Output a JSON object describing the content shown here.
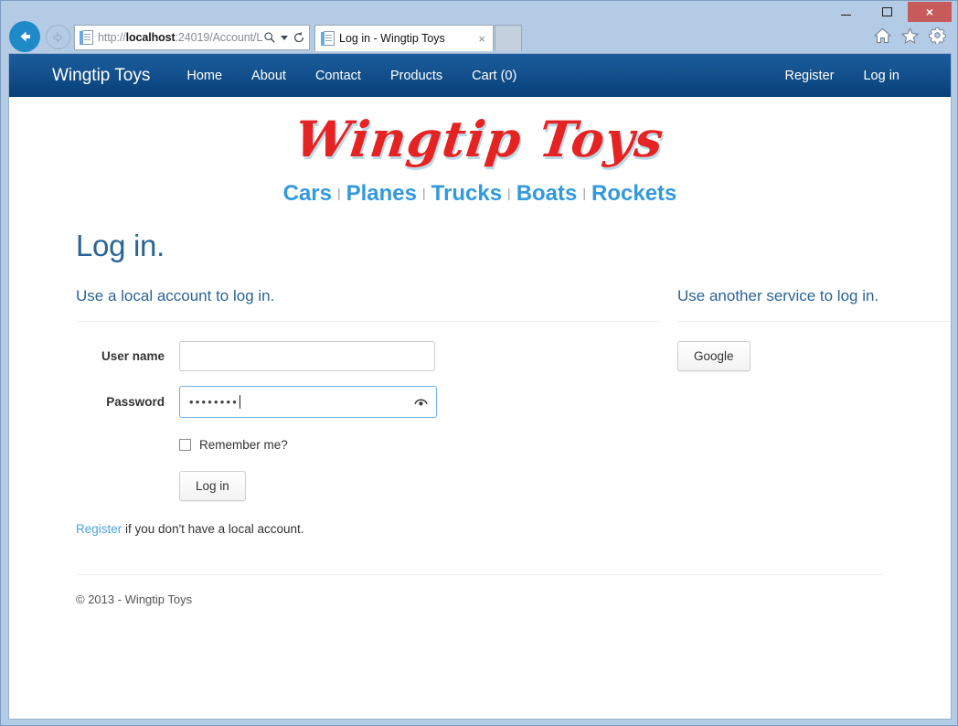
{
  "browser": {
    "url_prefix": "http://",
    "url_host": "localhost",
    "url_rest": ":24019/Account/L",
    "tab_title": "Log in - Wingtip Toys",
    "tab_close_label": "×",
    "back_label": "Back",
    "forward_label": "Forward",
    "refresh_label": "Refresh",
    "search_label": "Search",
    "new_tab_label": "New tab",
    "minimize_label": "Minimize",
    "maximize_label": "Maximize",
    "close_label": "×",
    "toolbar_icons": [
      "home-icon",
      "favorites-star-icon",
      "settings-gear-icon"
    ]
  },
  "navbar": {
    "brand": "Wingtip Toys",
    "links": [
      "Home",
      "About",
      "Contact",
      "Products",
      "Cart (0)"
    ],
    "right_links": [
      "Register",
      "Log in"
    ]
  },
  "site": {
    "logo_text": "Wingtip Toys",
    "categories": [
      "Cars",
      "Planes",
      "Trucks",
      "Boats",
      "Rockets"
    ],
    "category_separator": "|"
  },
  "page": {
    "title": "Log in.",
    "local": {
      "heading": "Use a local account to log in.",
      "username_label": "User name",
      "username_value": "",
      "password_label": "Password",
      "password_value": "••••••••",
      "password_reveal_icon": "eye-reveal-icon",
      "remember_label": "Remember me?",
      "remember_checked": false,
      "submit_label": "Log in",
      "register_link": "Register",
      "register_text": " if you don't have a local account."
    },
    "external": {
      "heading": "Use another service to log in.",
      "providers": [
        "Google"
      ]
    }
  },
  "footer": {
    "copyright": "© 2013 - Wingtip Toys"
  },
  "colors": {
    "navbar_top": "#1c5c9c",
    "navbar_bottom": "#073f78",
    "logo_red": "#e62323",
    "category_blue": "#3399dd",
    "heading_blue": "#2a6496",
    "focus_blue": "#6db3e8",
    "chrome_bg": "#b4cbe6",
    "close_button_red": "#c75b5b"
  }
}
